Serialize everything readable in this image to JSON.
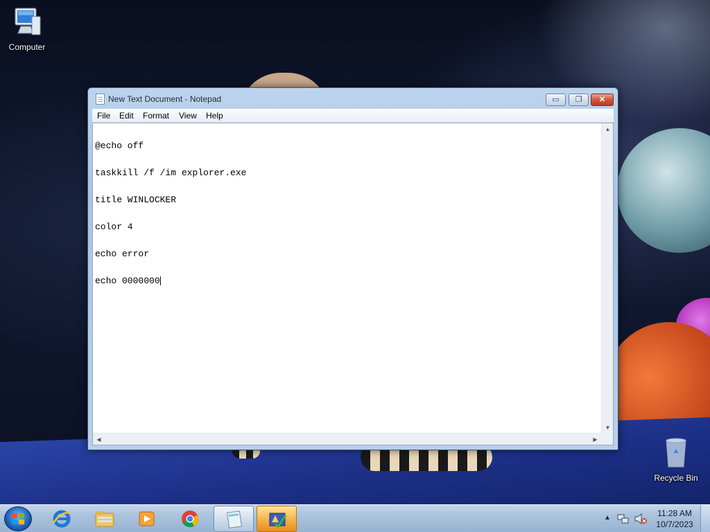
{
  "desktop": {
    "icons": [
      {
        "label": "Computer"
      },
      {
        "label": "Recycle Bin"
      }
    ]
  },
  "window": {
    "title": "New Text Document - Notepad",
    "controls": {
      "minimize": "▭",
      "maximize": "❐",
      "close": "✕"
    },
    "menu": [
      "File",
      "Edit",
      "Format",
      "View",
      "Help"
    ],
    "content_lines": [
      "@echo off",
      "taskkill /f /im explorer.exe",
      "title WINLOCKER",
      "color 4",
      "echo error",
      "echo 0000000"
    ]
  },
  "taskbar": {
    "apps": [
      {
        "name": "ie-icon",
        "active": false
      },
      {
        "name": "explorer-folder-icon",
        "active": false
      },
      {
        "name": "media-player-icon",
        "active": false
      },
      {
        "name": "chrome-icon",
        "active": false
      },
      {
        "name": "notepad-icon",
        "active": true
      },
      {
        "name": "flashing-app-icon",
        "active": true
      }
    ],
    "clock": {
      "time": "11:28 AM",
      "date": "10/7/2023"
    },
    "tray_icons": [
      "show-hidden-icons-arrow",
      "network-icon",
      "volume-muted-icon"
    ]
  },
  "colors": {
    "taskbar_accent": "#98b3d2",
    "close_button": "#c23a1e",
    "flash_highlight": "#f4b24a"
  }
}
